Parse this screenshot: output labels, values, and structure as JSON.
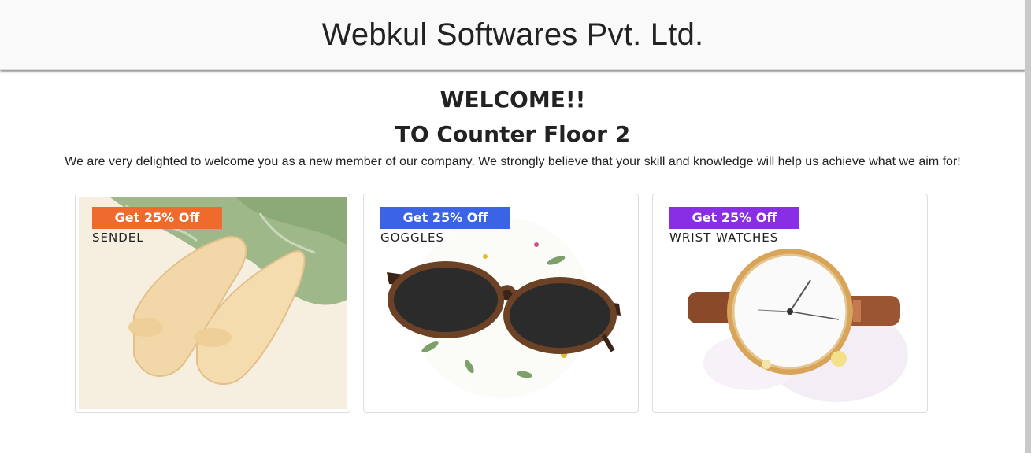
{
  "header": {
    "company": "Webkul Softwares Pvt. Ltd."
  },
  "welcome": {
    "line1": "WELCOME!!",
    "line2": "TO Counter Floor 2"
  },
  "intro": "We are very delighted to welcome you as a new member of our company. We strongly believe that your skill and knowledge will help us achieve what we aim for!",
  "cards": [
    {
      "badge": "Get 25% Off",
      "title": "SENDEL",
      "badge_color": "#ef6a2d"
    },
    {
      "badge": "Get 25% Off",
      "title": "GOGGLES",
      "badge_color": "#3a63e6"
    },
    {
      "badge": "Get 25% Off",
      "title": "WRIST WATCHES",
      "badge_color": "#8a2ee6"
    }
  ]
}
